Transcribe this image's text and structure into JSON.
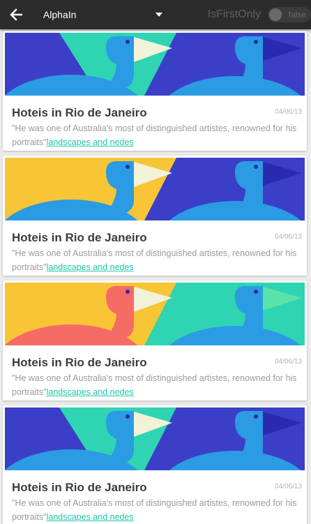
{
  "toolbar": {
    "back_icon": "arrow-left-icon",
    "dropdown_value": "AlphaIn",
    "dropdown_icon": "caret-down-icon",
    "toggle_label": "IsFirstOnly",
    "toggle_value": "false"
  },
  "colors": {
    "toolbar_bg": "#2c2c2c",
    "link": "#1cc7a8",
    "title": "#3c3c3c",
    "text": "#9a9a9a"
  },
  "cards": [
    {
      "title": "Hoteis in Rio de Janeiro",
      "date": "04/06/13",
      "desc": "\"He was one of Australia's most of distinguished artistes, renowned for his portraits\"",
      "link": "landscapes and nedes",
      "image": {
        "left_bg": "#2fd4b2",
        "left_bird": "#2b9be3",
        "left_beak": "#f2f2d8",
        "right_bg": "#3b3fc7",
        "right_bird": "#2b9be3",
        "right_beak": "#2a2ab0"
      }
    },
    {
      "title": "Hoteis in Rio de Janeiro",
      "date": "04/06/13",
      "desc": "\"He was one of Australia's most of distinguished artistes, renowned for his portraits\"",
      "link": "landscapes and nedes",
      "image": {
        "left_bg": "#f7c535",
        "left_bird": "#2b9be3",
        "left_beak": "#f2f2d8",
        "right_bg": "#3b3fc7",
        "right_bird": "#2b9be3",
        "right_beak": "#2a2ab0"
      }
    },
    {
      "title": "Hoteis in Rio de Janeiro",
      "date": "04/06/13",
      "desc": "\"He was one of Australia's most of distinguished artistes, renowned for his portraits\"",
      "link": "landscapes and nedes",
      "image": {
        "left_bg": "#f7c535",
        "left_bird": "#f56b66",
        "left_beak": "#f2f2d8",
        "right_bg": "#2fd4b2",
        "right_bird": "#2b9be3",
        "right_beak": "#5ae3a8"
      }
    },
    {
      "title": "Hoteis in Rio de Janeiro",
      "date": "04/06/13",
      "desc": "\"He was one of Australia's most of distinguished artistes, renowned for his portraits\"",
      "link": "landscapes and nedes",
      "image": {
        "left_bg": "#2fd4b2",
        "left_bird": "#2b9be3",
        "left_beak": "#f2f2d8",
        "right_bg": "#3b3fc7",
        "right_bird": "#2b9be3",
        "right_beak": "#2a2ab0"
      }
    }
  ]
}
